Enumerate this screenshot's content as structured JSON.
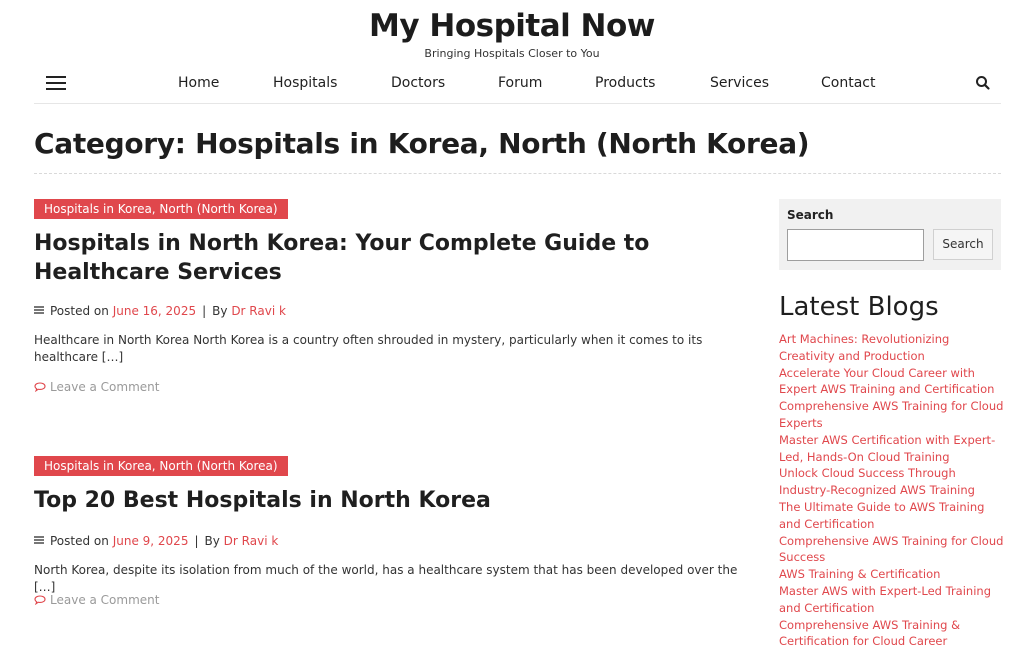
{
  "site": {
    "title": "My Hospital Now",
    "tagline": "Bringing Hospitals Closer to You"
  },
  "nav": {
    "items": [
      "Home",
      "Hospitals",
      "Doctors",
      "Forum",
      "Products",
      "Services",
      "Contact"
    ],
    "menu_icon": "hamburger-menu-icon",
    "search_icon": "search-icon"
  },
  "archive": {
    "title": "Category: Hospitals in Korea, North (North Korea)"
  },
  "posts": [
    {
      "category": "Hospitals in Korea, North (North Korea)",
      "title": "Hospitals in North Korea: Your Complete Guide to Healthcare Services",
      "posted_on_label": "Posted on",
      "date": "June 16, 2025",
      "by_label": "By",
      "author": "Dr Ravi k",
      "excerpt": "Healthcare in North Korea North Korea is a country often shrouded in mystery, particularly when it comes to its healthcare […]",
      "comment_link": "Leave a Comment"
    },
    {
      "category": "Hospitals in Korea, North (North Korea)",
      "title": "Top 20 Best Hospitals in North Korea",
      "posted_on_label": "Posted on",
      "date": "June 9, 2025",
      "by_label": "By",
      "author": "Dr Ravi k",
      "excerpt": "North Korea, despite its isolation from much of the world, has a healthcare system that has been developed over the […]",
      "comment_link": "Leave a Comment"
    }
  ],
  "sidebar": {
    "search": {
      "label": "Search",
      "input_value": "",
      "button_label": "Search"
    },
    "latest_heading": "Latest Blogs",
    "latest_items": [
      "Art Machines: Revolutionizing Creativity and Production",
      "Accelerate Your Cloud Career with Expert AWS Training and Certification",
      "Comprehensive AWS Training for Cloud Experts",
      "Master AWS Certification with Expert-Led, Hands-On Cloud Training",
      "Unlock Cloud Success Through Industry-Recognized AWS Training",
      "The Ultimate Guide to AWS Training and Certification",
      "Comprehensive AWS Training for Cloud Success",
      "AWS Training & Certification",
      "Master AWS with Expert-Led Training and Certification",
      "Comprehensive AWS Training & Certification for Cloud Career"
    ]
  },
  "colors": {
    "accent": "#e0474c",
    "text": "#1f1f1f",
    "muted": "#9a9a9a",
    "widget_bg": "#f1f1f1"
  }
}
